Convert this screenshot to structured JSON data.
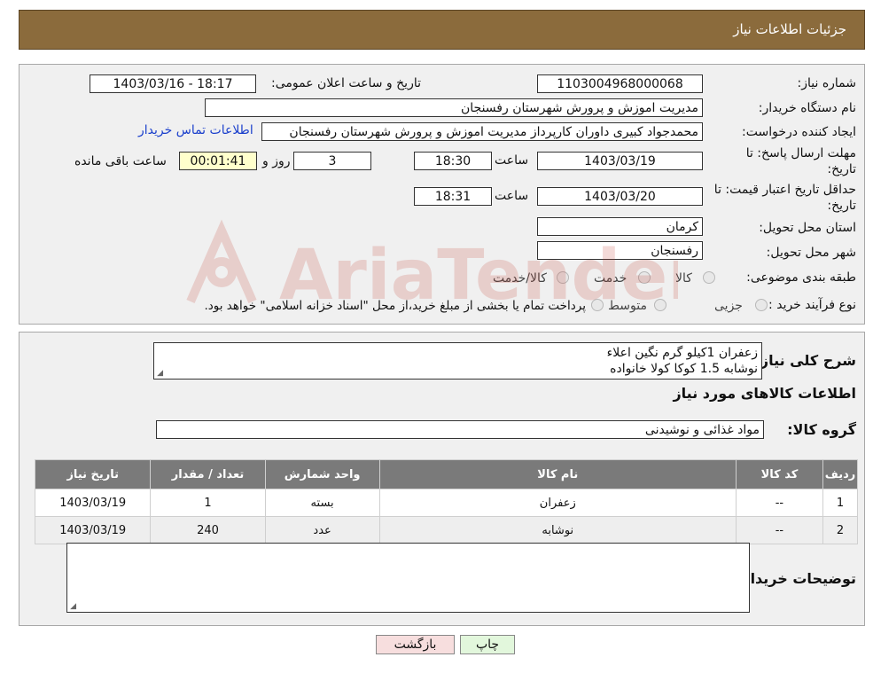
{
  "header": {
    "title": "جزئیات اطلاعات نیاز"
  },
  "fields": {
    "need_number_label": "شماره نیاز:",
    "need_number": "1103004968000068",
    "announce_label": "تاریخ و ساعت اعلان عمومی:",
    "announce_value": "1403/03/16 - 18:17",
    "buyer_org_label": "نام دستگاه خریدار:",
    "buyer_org": "مدیریت اموزش و پرورش شهرستان رفسنجان",
    "requester_label": "ایجاد کننده درخواست:",
    "requester": "محمدجواد کبیری داوران کارپرداز مدیریت اموزش و پرورش شهرستان رفسنجان",
    "contact_link": "اطلاعات تماس خریدار",
    "deadline_label_1": "مهلت ارسال پاسخ: تا",
    "deadline_label_2": "تاریخ:",
    "deadline_date": "1403/03/19",
    "time_word": "ساعت",
    "deadline_time": "18:30",
    "days_value": "3",
    "days_word": "روز و",
    "remaining_time": "00:01:41",
    "remaining_word": "ساعت باقی مانده",
    "validity_label_1": "حداقل تاریخ اعتبار قیمت: تا",
    "validity_label_2": "تاریخ:",
    "validity_date": "1403/03/20",
    "validity_time": "18:31",
    "province_label": "استان محل تحویل:",
    "province": "کرمان",
    "city_label": "شهر محل تحویل:",
    "city": "رفسنجان",
    "category_label": "طبقه بندی موضوعی:",
    "category_options": [
      "کالا",
      "خدمت",
      "کالا/خدمت"
    ],
    "process_label": "نوع فرآیند خرید :",
    "process_options": [
      "جزیی",
      "متوسط"
    ],
    "process_note": "پرداخت تمام یا بخشی از مبلغ خرید،از محل \"اسناد خزانه اسلامی\" خواهد بود."
  },
  "details": {
    "desc_label": "شرح کلی نیاز:",
    "desc_lines": [
      "زعفران 1کیلو گرم نگین اعلاء",
      "نوشابه 1.5 کوکا کولا خانواده"
    ],
    "goods_info_title": "اطلاعات کالاهای مورد نیاز",
    "group_label": "گروه کالا:",
    "group_value": "مواد غذائی و نوشیدنی",
    "table_headers": [
      "ردیف",
      "کد کالا",
      "نام کالا",
      "واحد شمارش",
      "تعداد / مقدار",
      "تاریخ نیاز"
    ],
    "table_rows": [
      [
        "1",
        "--",
        "زعفران",
        "بسته",
        "1",
        "1403/03/19"
      ],
      [
        "2",
        "--",
        "نوشابه",
        "عدد",
        "240",
        "1403/03/19"
      ]
    ],
    "buyer_notes_label": "توضیحات خریدار:"
  },
  "buttons": {
    "print": "چاپ",
    "back": "بازگشت"
  },
  "watermark": {
    "text": "AriaTender.neT",
    "color": "#c0392b"
  },
  "colors": {
    "header_bg": "#8b6b3c",
    "table_header_bg": "#7a7a7a",
    "back_button_bg": "#f7dede",
    "print_button_bg": "#e2f7dc",
    "timer_bg": "#ffffcc"
  }
}
